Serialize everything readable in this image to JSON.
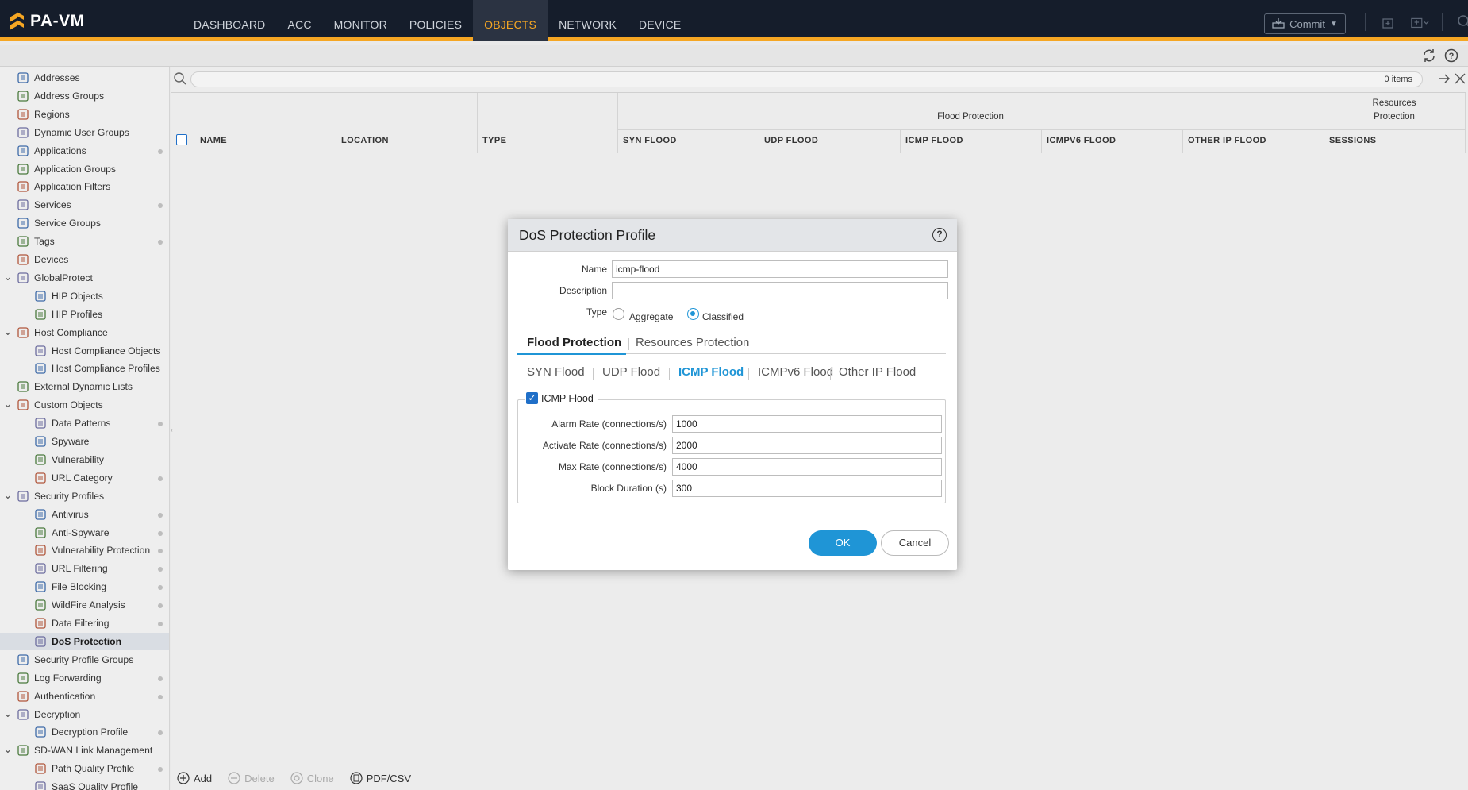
{
  "app": {
    "logo_text": "PA-VM"
  },
  "nav": [
    {
      "label": "DASHBOARD"
    },
    {
      "label": "ACC"
    },
    {
      "label": "MONITOR"
    },
    {
      "label": "POLICIES"
    },
    {
      "label": "OBJECTS",
      "active": true
    },
    {
      "label": "NETWORK"
    },
    {
      "label": "DEVICE"
    }
  ],
  "header": {
    "commit_label": "Commit"
  },
  "sidebar": {
    "items": [
      {
        "label": "Addresses",
        "icon": "addresses-icon"
      },
      {
        "label": "Address Groups",
        "icon": "address-groups-icon"
      },
      {
        "label": "Regions",
        "icon": "regions-icon"
      },
      {
        "label": "Dynamic User Groups",
        "icon": "dynamic-user-groups-icon"
      },
      {
        "label": "Applications",
        "icon": "applications-icon"
      },
      {
        "label": "Application Groups",
        "icon": "application-groups-icon"
      },
      {
        "label": "Application Filters",
        "icon": "application-filters-icon"
      },
      {
        "label": "Services",
        "icon": "services-icon"
      },
      {
        "label": "Service Groups",
        "icon": "service-groups-icon"
      },
      {
        "label": "Tags",
        "icon": "tags-icon"
      },
      {
        "label": "Devices",
        "icon": "devices-icon"
      },
      {
        "label": "GlobalProtect",
        "icon": "globalprotect-icon"
      },
      {
        "label": "HIP Objects",
        "icon": "hip-objects-icon"
      },
      {
        "label": "HIP Profiles",
        "icon": "hip-profiles-icon"
      },
      {
        "label": "Host Compliance",
        "icon": "host-compliance-icon"
      },
      {
        "label": "Host Compliance Objects",
        "icon": "host-compliance-objects-icon"
      },
      {
        "label": "Host Compliance Profiles",
        "icon": "host-compliance-profiles-icon"
      },
      {
        "label": "External Dynamic Lists",
        "icon": "external-dynamic-lists-icon"
      },
      {
        "label": "Custom Objects",
        "icon": "custom-objects-icon"
      },
      {
        "label": "Data Patterns",
        "icon": "data-patterns-icon"
      },
      {
        "label": "Spyware",
        "icon": "spyware-icon"
      },
      {
        "label": "Vulnerability",
        "icon": "vulnerability-icon"
      },
      {
        "label": "URL Category",
        "icon": "url-category-icon"
      },
      {
        "label": "Security Profiles",
        "icon": "security-profiles-icon"
      },
      {
        "label": "Antivirus",
        "icon": "antivirus-icon"
      },
      {
        "label": "Anti-Spyware",
        "icon": "anti-spyware-icon"
      },
      {
        "label": "Vulnerability Protection",
        "icon": "vulnerability-protection-icon"
      },
      {
        "label": "URL Filtering",
        "icon": "url-filtering-icon"
      },
      {
        "label": "File Blocking",
        "icon": "file-blocking-icon"
      },
      {
        "label": "WildFire Analysis",
        "icon": "wildfire-analysis-icon"
      },
      {
        "label": "Data Filtering",
        "icon": "data-filtering-icon"
      },
      {
        "label": "DoS Protection",
        "icon": "dos-protection-icon"
      },
      {
        "label": "Security Profile Groups",
        "icon": "security-profile-groups-icon"
      },
      {
        "label": "Log Forwarding",
        "icon": "log-forwarding-icon"
      },
      {
        "label": "Authentication",
        "icon": "authentication-icon"
      },
      {
        "label": "Decryption",
        "icon": "decryption-icon"
      },
      {
        "label": "Decryption Profile",
        "icon": "decryption-profile-icon"
      },
      {
        "label": "SD-WAN Link Management",
        "icon": "sdwan-link-management-icon"
      },
      {
        "label": "Path Quality Profile",
        "icon": "path-quality-profile-icon"
      },
      {
        "label": "SaaS Quality Profile",
        "icon": "saas-quality-profile-icon"
      }
    ]
  },
  "main": {
    "items_count": "0 items",
    "table": {
      "group_flood": "Flood Protection",
      "group_resources_line1": "Resources",
      "group_resources_line2": "Protection",
      "columns": [
        "NAME",
        "LOCATION",
        "TYPE",
        "SYN FLOOD",
        "UDP FLOOD",
        "ICMP FLOOD",
        "ICMPV6 FLOOD",
        "OTHER IP FLOOD",
        "SESSIONS"
      ]
    },
    "footer": {
      "add": "Add",
      "delete": "Delete",
      "clone": "Clone",
      "pdf_csv": "PDF/CSV"
    }
  },
  "modal": {
    "title": "DoS Protection Profile",
    "name_label": "Name",
    "name_value": "icmp-flood",
    "description_label": "Description",
    "description_value": "",
    "type_label": "Type",
    "type_options": [
      "Aggregate",
      "Classified"
    ],
    "type_selected": "Classified",
    "tabs": [
      "Flood Protection",
      "Resources Protection"
    ],
    "active_tab": "Flood Protection",
    "subtabs": [
      "SYN Flood",
      "UDP Flood",
      "ICMP Flood",
      "ICMPv6 Flood",
      "Other IP Flood"
    ],
    "active_subtab": "ICMP Flood",
    "section_label": "ICMP Flood",
    "section_checked": true,
    "fields": [
      {
        "label": "Alarm Rate (connections/s)",
        "value": "1000"
      },
      {
        "label": "Activate Rate (connections/s)",
        "value": "2000"
      },
      {
        "label": "Max Rate (connections/s)",
        "value": "4000"
      },
      {
        "label": "Block Duration (s)",
        "value": "300"
      }
    ],
    "ok_label": "OK",
    "cancel_label": "Cancel"
  },
  "colors": {
    "topbar": "#151d2b",
    "accent_orange": "#f5a623",
    "accent_blue": "#1f95d6"
  }
}
